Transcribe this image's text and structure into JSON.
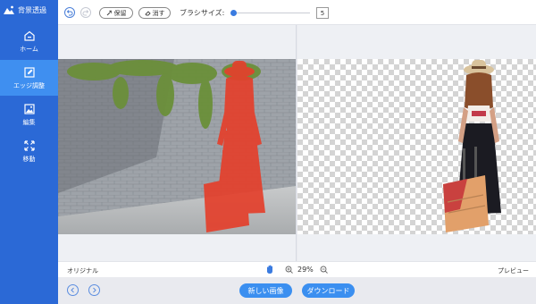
{
  "app": {
    "title": "背景透過"
  },
  "sidebar": {
    "items": [
      {
        "label": "ホーム",
        "icon": "home-icon",
        "active": false
      },
      {
        "label": "エッジ調整",
        "icon": "edit-icon",
        "active": true
      },
      {
        "label": "編集",
        "icon": "image-icon",
        "active": false
      },
      {
        "label": "移動",
        "icon": "move-icon",
        "active": false
      }
    ]
  },
  "toolbar": {
    "keep_label": "保留",
    "erase_label": "消す",
    "brush_label": "ブラシサイズ:",
    "brush_size": "5"
  },
  "status": {
    "original_label": "オリジナル",
    "preview_label": "プレビュー",
    "zoom": "29%"
  },
  "actions": {
    "new_image": "新しい画像",
    "download": "ダウンロード"
  },
  "colors": {
    "sidebar_bg": "#2b69d6",
    "sidebar_active": "#3f8ff0",
    "primary_button": "#3b8ff0",
    "mask_overlay": "#e4402c"
  }
}
